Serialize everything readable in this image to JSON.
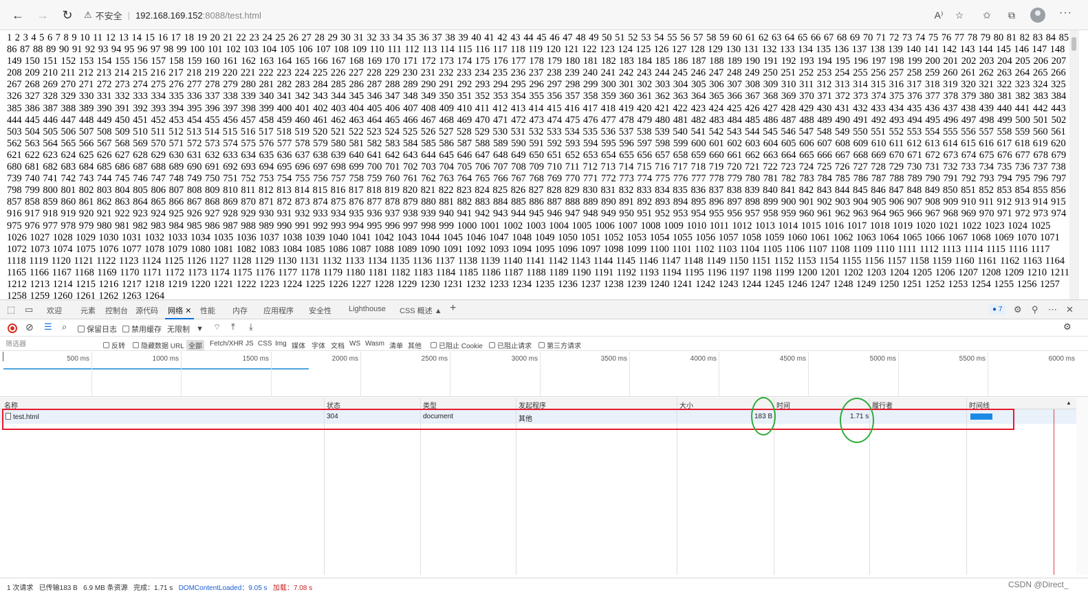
{
  "browser": {
    "back": "←",
    "forward": "→",
    "reload": "↻",
    "insecure_label": "不安全",
    "url_host": "192.168.169.152",
    "url_path": ":8088/test.html",
    "icons": [
      "read-aloud-icon",
      "favorite-star-icon",
      "favorites-icon",
      "collections-icon",
      "profile-avatar",
      "more-icon"
    ]
  },
  "page": {
    "count_start": 1,
    "count_end": 1264
  },
  "devtools": {
    "tabs": {
      "welcome": "欢迎",
      "elements": "元素",
      "console": "控制台",
      "sources": "源代码",
      "network": "网络",
      "performance": "性能",
      "memory": "内存",
      "application": "应用程序",
      "security": "安全性",
      "lighthouse": "Lighthouse",
      "css_overview": "CSS 概述"
    },
    "issues_count": "7",
    "toolbar": {
      "preserve_log": "保留日志",
      "disable_cache": "禁用缓存",
      "throttle": "无限制"
    },
    "filter": {
      "placeholder": "筛选器",
      "invert": "反转",
      "hide_data_urls": "隐藏数据 URL",
      "all": "全部",
      "types": [
        "Fetch/XHR",
        "JS",
        "CSS",
        "Img",
        "媒体",
        "字体",
        "文档",
        "WS",
        "Wasm",
        "清单",
        "其他"
      ],
      "blocked_cookies": "已阻止 Cookie",
      "blocked_requests": "已阻止请求",
      "third_party": "第三方请求"
    },
    "overview_ticks": [
      "500 ms",
      "1000 ms",
      "1500 ms",
      "2000 ms",
      "2500 ms",
      "3000 ms",
      "3500 ms",
      "4000 ms",
      "4500 ms",
      "5000 ms",
      "5500 ms",
      "6000 ms"
    ],
    "columns": {
      "name": "名称",
      "status": "状态",
      "type": "类型",
      "initiator": "发起程序",
      "size": "大小",
      "time": "时间",
      "priority": "履行者",
      "waterfall": "时间线"
    },
    "rows": [
      {
        "name": "test.html",
        "status": "304",
        "type": "document",
        "initiator": "其他",
        "size": "183 B",
        "time": "1.71 s"
      }
    ],
    "status_bar": {
      "requests": "1 次请求",
      "transferred": "已传输183 B",
      "resources": "6.9 MB 条资源",
      "finish": "完成：1.71 s",
      "dom_content_loaded": "DOMContentLoaded：9.05 s",
      "load": "加载：7.08 s"
    }
  },
  "watermark": "CSDN @Direct_"
}
